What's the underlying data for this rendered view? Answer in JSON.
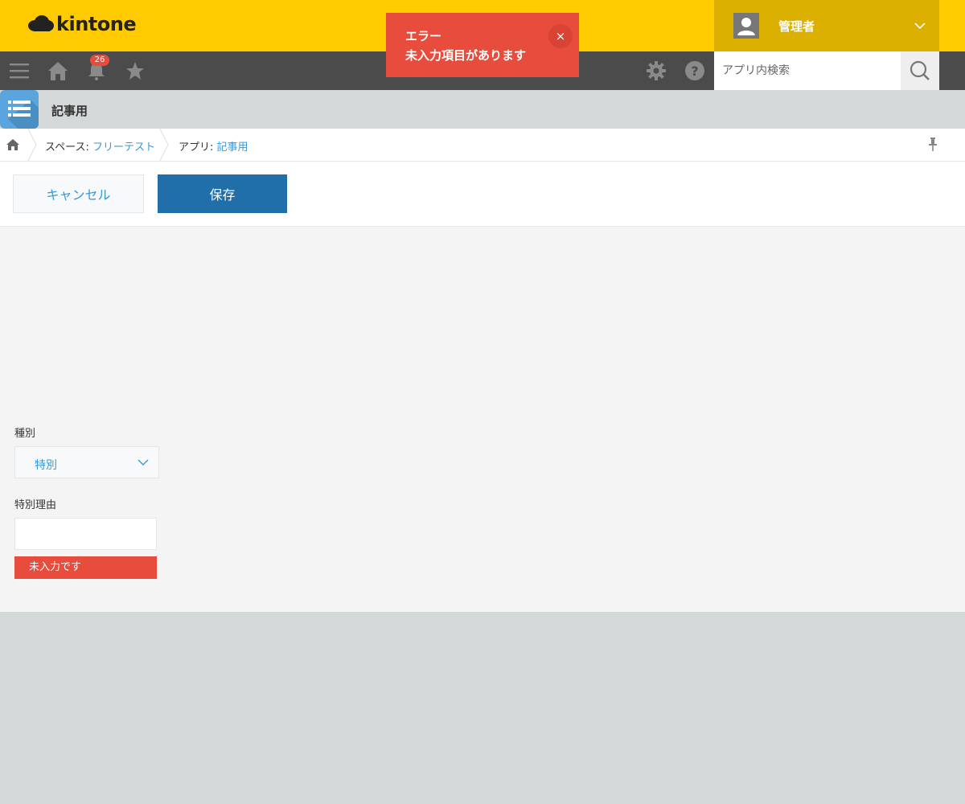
{
  "header": {
    "brand": "kintone",
    "user_name": "管理者"
  },
  "toast": {
    "title": "エラー",
    "message": "未入力項目があります",
    "close_label": "×"
  },
  "toolbar": {
    "notification_count": "26",
    "search_placeholder": "アプリ内検索"
  },
  "app": {
    "title": "記事用"
  },
  "breadcrumb": {
    "space_prefix": "スペース: ",
    "space_name": "フリーテスト",
    "app_prefix": "アプリ: ",
    "app_name": "記事用"
  },
  "actions": {
    "cancel_label": "キャンセル",
    "save_label": "保存"
  },
  "form": {
    "kind_label": "種別",
    "kind_value": "特別",
    "reason_label": "特別理由",
    "reason_value": "",
    "reason_error": "未入力です"
  },
  "colors": {
    "header": "#ffcb00",
    "toolbar": "#4b4b4b",
    "error": "#e74c3c",
    "primary": "#206fa8",
    "link": "#3498db"
  }
}
